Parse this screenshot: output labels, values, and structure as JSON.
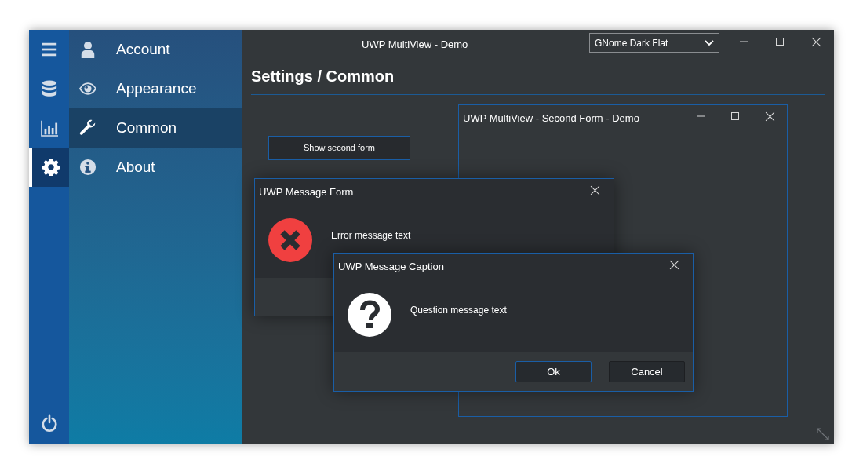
{
  "rail": {
    "items": [
      {
        "kind": "menu",
        "selected": false
      },
      {
        "kind": "database",
        "selected": false
      },
      {
        "kind": "chart",
        "selected": false
      },
      {
        "kind": "settings",
        "selected": true
      }
    ],
    "bottom": {
      "kind": "power"
    }
  },
  "nav": {
    "items": [
      {
        "kind": "user",
        "label": "Account",
        "selected": false
      },
      {
        "kind": "eye",
        "label": "Appearance",
        "selected": false
      },
      {
        "kind": "wrench",
        "label": "Common",
        "selected": true
      },
      {
        "kind": "info",
        "label": "About",
        "selected": false
      }
    ]
  },
  "window": {
    "title": "UWP MultiView - Demo",
    "theme_dropdown": {
      "value": "GNome Dark Flat"
    }
  },
  "page": {
    "heading": "Settings / Common",
    "button": "Show second form"
  },
  "second_form": {
    "title": "UWP MultiView - Second Form - Demo"
  },
  "dialogs": [
    {
      "title": "UWP Message Form",
      "kind": "error",
      "message": "Error message text"
    },
    {
      "title": "UWP Message Caption",
      "kind": "question",
      "message": "Question message text",
      "buttons": [
        {
          "label": "Ok",
          "default": true
        },
        {
          "label": "Cancel",
          "default": false
        }
      ]
    }
  ]
}
